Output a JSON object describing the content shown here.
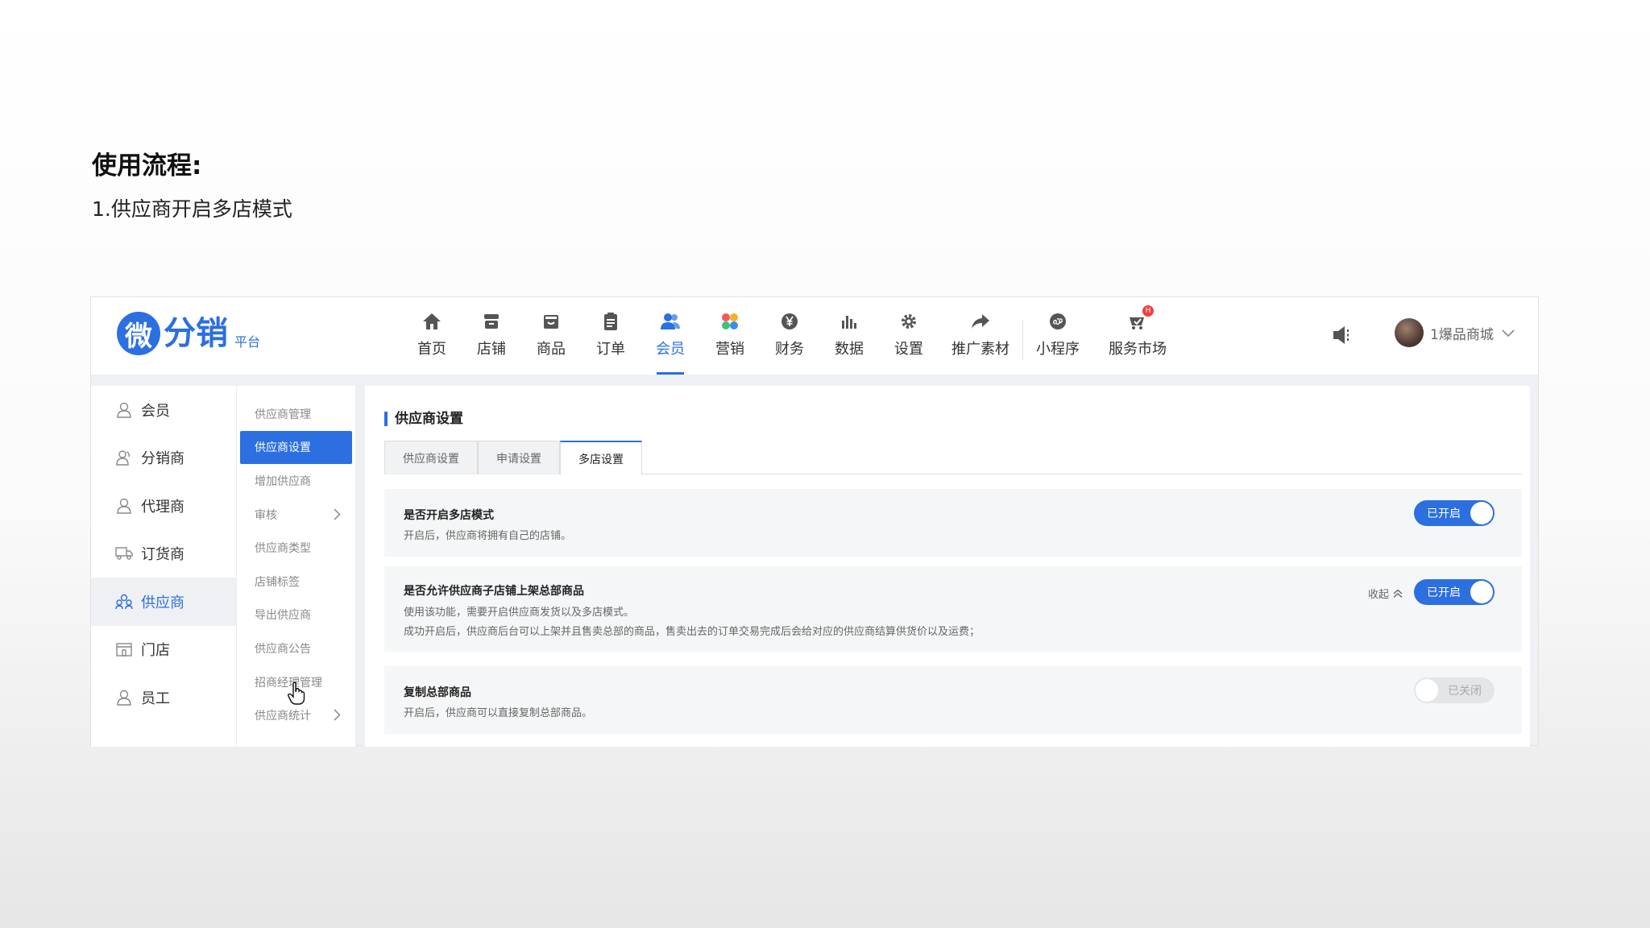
{
  "doc": {
    "heading": "使用流程:",
    "step": "1.供应商开启多店模式"
  },
  "logo": {
    "mark": "微",
    "text": "分销",
    "sub": "平台"
  },
  "nav": {
    "items": [
      {
        "label": "首页",
        "icon": "home-icon"
      },
      {
        "label": "店铺",
        "icon": "store-icon"
      },
      {
        "label": "商品",
        "icon": "box-icon"
      },
      {
        "label": "订单",
        "icon": "clipboard-icon"
      },
      {
        "label": "会员",
        "icon": "users-icon",
        "active": true
      },
      {
        "label": "营销",
        "icon": "marketing-icon"
      },
      {
        "label": "财务",
        "icon": "yen-icon"
      },
      {
        "label": "数据",
        "icon": "bar-chart-icon"
      },
      {
        "label": "设置",
        "icon": "gear-icon"
      },
      {
        "label": "推广素材",
        "icon": "share-icon"
      },
      {
        "label": "小程序",
        "icon": "mini-program-icon"
      },
      {
        "label": "服务市场",
        "icon": "service-market-icon",
        "badge": "H"
      }
    ]
  },
  "header": {
    "user_name": "1爆品商城"
  },
  "side_menu": {
    "items": [
      {
        "label": "会员",
        "icon": "member-icon"
      },
      {
        "label": "分销商",
        "icon": "distributor-icon"
      },
      {
        "label": "代理商",
        "icon": "agent-icon"
      },
      {
        "label": "订货商",
        "icon": "truck-icon"
      },
      {
        "label": "供应商",
        "icon": "supplier-icon",
        "active": true
      },
      {
        "label": "门店",
        "icon": "shop-icon"
      },
      {
        "label": "员工",
        "icon": "staff-icon"
      }
    ]
  },
  "sub_menu": {
    "items": [
      {
        "label": "供应商管理"
      },
      {
        "label": "供应商设置",
        "active": true
      },
      {
        "label": "增加供应商"
      },
      {
        "label": "审核",
        "has_chevron": true
      },
      {
        "label": "供应商类型"
      },
      {
        "label": "店铺标签"
      },
      {
        "label": "导出供应商"
      },
      {
        "label": "供应商公告"
      },
      {
        "label": "招商经理管理"
      },
      {
        "label": "供应商统计",
        "has_chevron": true
      }
    ]
  },
  "main": {
    "title": "供应商设置",
    "tabs": [
      {
        "label": "供应商设置"
      },
      {
        "label": "申请设置"
      },
      {
        "label": "多店设置",
        "active": true
      }
    ],
    "settings": [
      {
        "title": "是否开启多店模式",
        "desc1": "开启后，供应商将拥有自己的店铺。",
        "toggle_label": "已开启",
        "on": true
      },
      {
        "title": "是否允许供应商子店铺上架总部商品",
        "desc1": "使用该功能，需要开启供应商发货以及多店模式。",
        "desc2": "成功开启后，供应商后台可以上架并且售卖总部的商品，售卖出去的订单交易完成后会给对应的供应商结算供货价以及运费；",
        "collapse_label": "收起",
        "toggle_label": "已开启",
        "on": true
      },
      {
        "title": "复制总部商品",
        "desc1": "开启后，供应商可以直接复制总部商品。",
        "toggle_label": "已关闭",
        "on": false
      }
    ]
  },
  "colors": {
    "accent": "#2b6fe0",
    "badge": "#f04040"
  }
}
